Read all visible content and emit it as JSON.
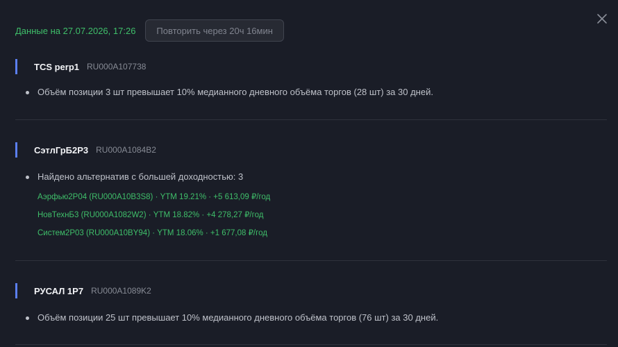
{
  "header": {
    "data_date": "Данные на 27.07.2026, 17:26",
    "retry_label": "Повторить через 20ч 16мин"
  },
  "sections": [
    {
      "name": "TCS perp1",
      "isin": "RU000A107738",
      "bullet": "Объём позиции 3 шт превышает 10% медианного дневного объёма торгов (28 шт) за 30 дней."
    },
    {
      "name": "СэтлГрБ2Р3",
      "isin": "RU000A1084B2",
      "bullet": "Найдено альтернатив с большей доходностью: 3",
      "alternatives": [
        "Аэрфью2Р04 (RU000A10B3S8) · YTM 19.21% · +5 613,09 ₽/год",
        "НовТехнБ3 (RU000A1082W2) · YTM 18.82% · +4 278,27 ₽/год",
        "Систем2Р03 (RU000A10BY94) · YTM 18.06% · +1 677,08 ₽/год"
      ]
    },
    {
      "name": "РУСАЛ 1Р7",
      "isin": "RU000A1089K2",
      "bullet": "Объём позиции 25 шт превышает 10% медианного дневного объёма торгов (76 шт) за 30 дней."
    }
  ],
  "colors": {
    "background": "#1a1d27",
    "accent_bar": "#5b7ff0",
    "green_text": "#3fbf6a"
  },
  "icons": {
    "close": "close-icon"
  }
}
